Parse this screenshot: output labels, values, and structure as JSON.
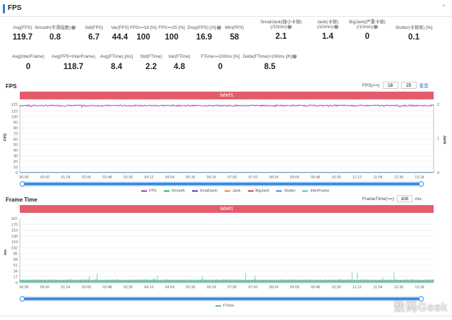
{
  "header": {
    "title": "FPS",
    "collapse_icon": "chevron-up-icon"
  },
  "stats_row1": [
    {
      "label": "Avg(FPS)",
      "value": "119.7",
      "help": false
    },
    {
      "label": "Smooth(平滑指数)",
      "value": "0.8",
      "help": true
    },
    {
      "label": "Std(FPS)",
      "value": "6.7",
      "help": false
    },
    {
      "label": "Var(FPS)",
      "value": "44.4",
      "help": false
    },
    {
      "label": "FPS>=18 [%]",
      "value": "100",
      "help": false
    },
    {
      "label": "FPS>=25 [%]",
      "value": "100",
      "help": false
    },
    {
      "label": "Drop(FPS) [/h]",
      "value": "16.9",
      "help": true
    },
    {
      "label": "Min(FPS)",
      "value": "58",
      "help": false
    },
    {
      "label": "SmallJank(微小卡顿)",
      "label2": "(/10min)",
      "value": "2.1",
      "help": true
    },
    {
      "label": "Jank(卡顿)",
      "label2": "(/10min)",
      "value": "1.4",
      "help": true
    },
    {
      "label": "BigJank(严重卡顿)",
      "label2": "(/10min)",
      "value": "0",
      "help": true
    },
    {
      "label": "Stutter(卡顿率) [%]",
      "value": "0.1",
      "help": false
    }
  ],
  "stats_row2": [
    {
      "label": "Avg(InterFrame)",
      "value": "0",
      "help": false
    },
    {
      "label": "Avg(FPS+InterFrame)",
      "value": "118.7",
      "help": false
    },
    {
      "label": "Avg(FTime) [ms]",
      "value": "8.4",
      "help": false
    },
    {
      "label": "Std(FTime)",
      "value": "2.2",
      "help": false
    },
    {
      "label": "Var(FTime)",
      "value": "4.8",
      "help": false
    },
    {
      "label": "FTime>=100ms [%]",
      "value": "0",
      "help": false
    },
    {
      "label": "Delta(FTime)>100ms [/h]",
      "value": "8.5",
      "help": true
    }
  ],
  "fps_section": {
    "title": "FPS",
    "filter_label": "FPS(>=)",
    "filter_value1": "18",
    "filter_value2": "25",
    "reset_label": "重置",
    "banner": "label1"
  },
  "ftime_section": {
    "title": "Frame Time",
    "filter_label": "FrameTime(>=)",
    "filter_value": "100",
    "filter_unit": "ms",
    "banner": "label1"
  },
  "watermark": "数码Geek",
  "chart_data": [
    {
      "type": "line",
      "x_tick_labels": [
        "00:00",
        "00:42",
        "01:24",
        "02:06",
        "02:48",
        "03:30",
        "04:12",
        "04:54",
        "05:36",
        "06:18",
        "07:00",
        "07:42",
        "08:24",
        "09:06",
        "09:48",
        "10:30",
        "11:12",
        "11:54",
        "12:36",
        "13:18"
      ],
      "y_left_ticks": [
        122,
        110,
        100,
        90,
        80,
        70,
        60,
        50,
        40,
        30,
        20,
        10,
        0
      ],
      "ylabel": "FPS",
      "ylim": [
        0,
        122
      ],
      "y_right_ticks": [
        2,
        1,
        0
      ],
      "y_right_label": "Jank",
      "series": [
        {
          "name": "FPS",
          "color": "#a23cb8",
          "mean": 119.7,
          "min": 115,
          "max": 122
        },
        {
          "name": "Smooth",
          "color": "#3cb371",
          "values_const": 0
        },
        {
          "name": "SmallJank",
          "color": "#5a3fc0",
          "values_const": 0
        },
        {
          "name": "Jank",
          "color": "#f08c3c",
          "values_const": 0
        },
        {
          "name": "BigJank",
          "color": "#e0444e",
          "values_const": 0
        },
        {
          "name": "Stutter",
          "color": "#4a90e2",
          "values_const": 0
        },
        {
          "name": "InterFrame",
          "color": "#4ac6d8",
          "values_const": 0
        }
      ],
      "grid": true,
      "legend": "bottom"
    },
    {
      "type": "bar",
      "x_tick_labels": [
        "00:00",
        "00:42",
        "01:24",
        "02:06",
        "02:48",
        "03:30",
        "04:12",
        "04:54",
        "05:36",
        "06:18",
        "07:00",
        "07:42",
        "08:24",
        "09:06",
        "09:48",
        "10:30",
        "11:12",
        "11:54",
        "12:36",
        "13:18"
      ],
      "y_ticks": [
        187,
        170,
        153,
        136,
        119,
        102,
        85,
        68,
        51,
        34,
        17,
        0
      ],
      "ylabel": "ms",
      "ylim": [
        0,
        187
      ],
      "series": [
        {
          "name": "FTime",
          "color": "#5fb89a",
          "mean": 8.4,
          "spikes_max": 34
        }
      ],
      "grid": true,
      "legend": "bottom"
    }
  ]
}
